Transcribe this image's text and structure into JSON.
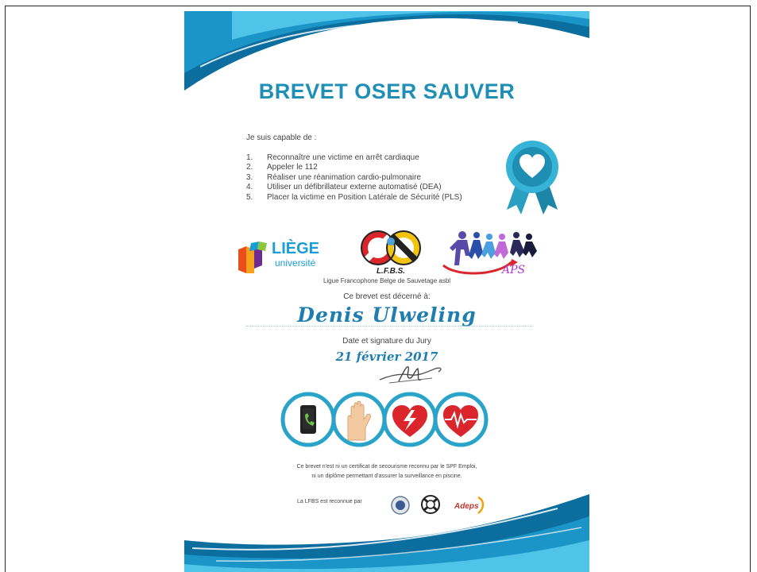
{
  "certificate": {
    "title": "BREVET OSER SAUVER",
    "intro": "Je suis capable de :",
    "skills": [
      {
        "num": "1.",
        "text": "Reconnaître une victime en arrêt cardiaque"
      },
      {
        "num": "2.",
        "text": "Appeler le 112"
      },
      {
        "num": "3.",
        "text": "Réaliser une réanimation cardio-pulmonaire"
      },
      {
        "num": "4.",
        "text": "Utiliser un défibrillateur externe automatisé (DEA)"
      },
      {
        "num": "5.",
        "text": "Placer la victime en Position Latérale de Sécurité (PLS)"
      }
    ],
    "logos": {
      "liege_name": "LIÈGE",
      "liege_sub": "université",
      "lfbs": "L.F.B.S.",
      "aps": "APS"
    },
    "league": "Ligue Francophone Belge de Sauvetage asbl",
    "awarded_to_label": "Ce brevet est décerné à:",
    "recipient": "Denis Ulweling",
    "jury_label": "Date et signature du Jury",
    "date": "21 février 2017",
    "disclaimer_line1": "Ce brevet n'est ni un certificat de secourisme reconnu par le SPF Emploi,",
    "disclaimer_line2": "ni un diplôme permettant d'assurer la surveillance en piscine.",
    "recognized_by": "La LFBS est reconnue par",
    "partner_adeps": "Adeps"
  },
  "colors": {
    "title": "#1f8fb5",
    "wave_dark": "#0b6e9e",
    "wave_light": "#4fc3e8",
    "circle_ring": "#2aa3c9",
    "heart_red": "#d9252b"
  },
  "icons": [
    "heart-ribbon-icon",
    "phone-icon",
    "hands-icon",
    "heart-defibrillator-icon",
    "heart-pulse-icon"
  ]
}
